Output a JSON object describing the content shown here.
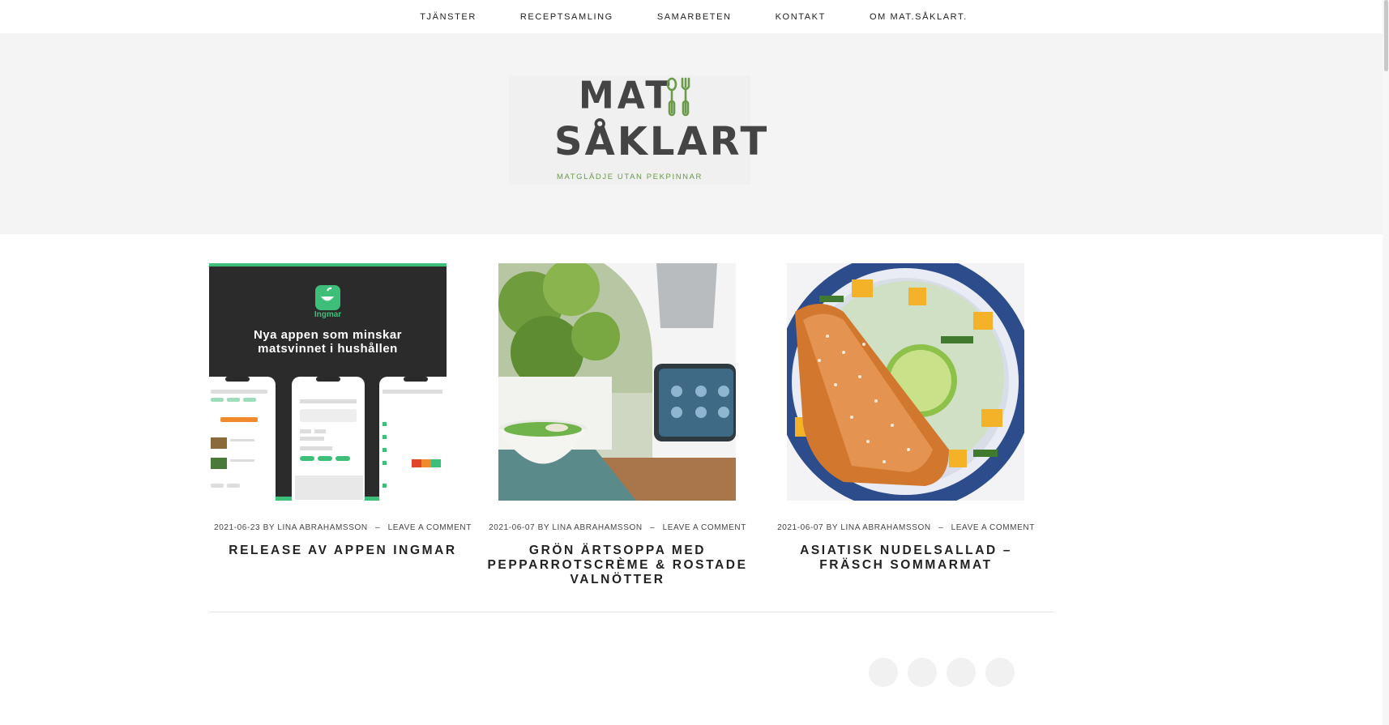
{
  "nav": {
    "items": [
      "TJÄNSTER",
      "RECEPTSAMLING",
      "SAMARBETEN",
      "KONTAKT",
      "OM MAT.SÅKLART."
    ]
  },
  "logo": {
    "tagline": "MATGLÄDJE UTAN PEKPINNAR",
    "text_line1": "MAT",
    "text_line2": "SÅKLART"
  },
  "posts": [
    {
      "date": "2021-06-23",
      "by": "BY",
      "author": "LINA ABRAHAMSSON",
      "sep": "–",
      "comment": "LEAVE A COMMENT",
      "title": "RELEASE AV APPEN INGMAR",
      "image_text": {
        "app_name": "Ingmar",
        "headline_1": "Nya appen som minskar",
        "headline_2": "matsvinnet i hushållen"
      }
    },
    {
      "date": "2021-06-07",
      "by": "BY",
      "author": "LINA ABRAHAMSSON",
      "sep": "–",
      "comment": "LEAVE A COMMENT",
      "title": "GRÖN ÄRTSOPPA MED PEPPARROTSCRÈME & ROSTADE VALNÖTTER"
    },
    {
      "date": "2021-06-07",
      "by": "BY",
      "author": "LINA ABRAHAMSSON",
      "sep": "–",
      "comment": "LEAVE A COMMENT",
      "title": "ASIATISK NUDELSALLAD – FRÄSCH SOMMARMAT"
    }
  ],
  "colors": {
    "hero_bg": "#f4f4f4",
    "accent_green": "#6a9a4a",
    "ingmar_green": "#3dbf7a",
    "dark_panel": "#2b2b2b"
  }
}
